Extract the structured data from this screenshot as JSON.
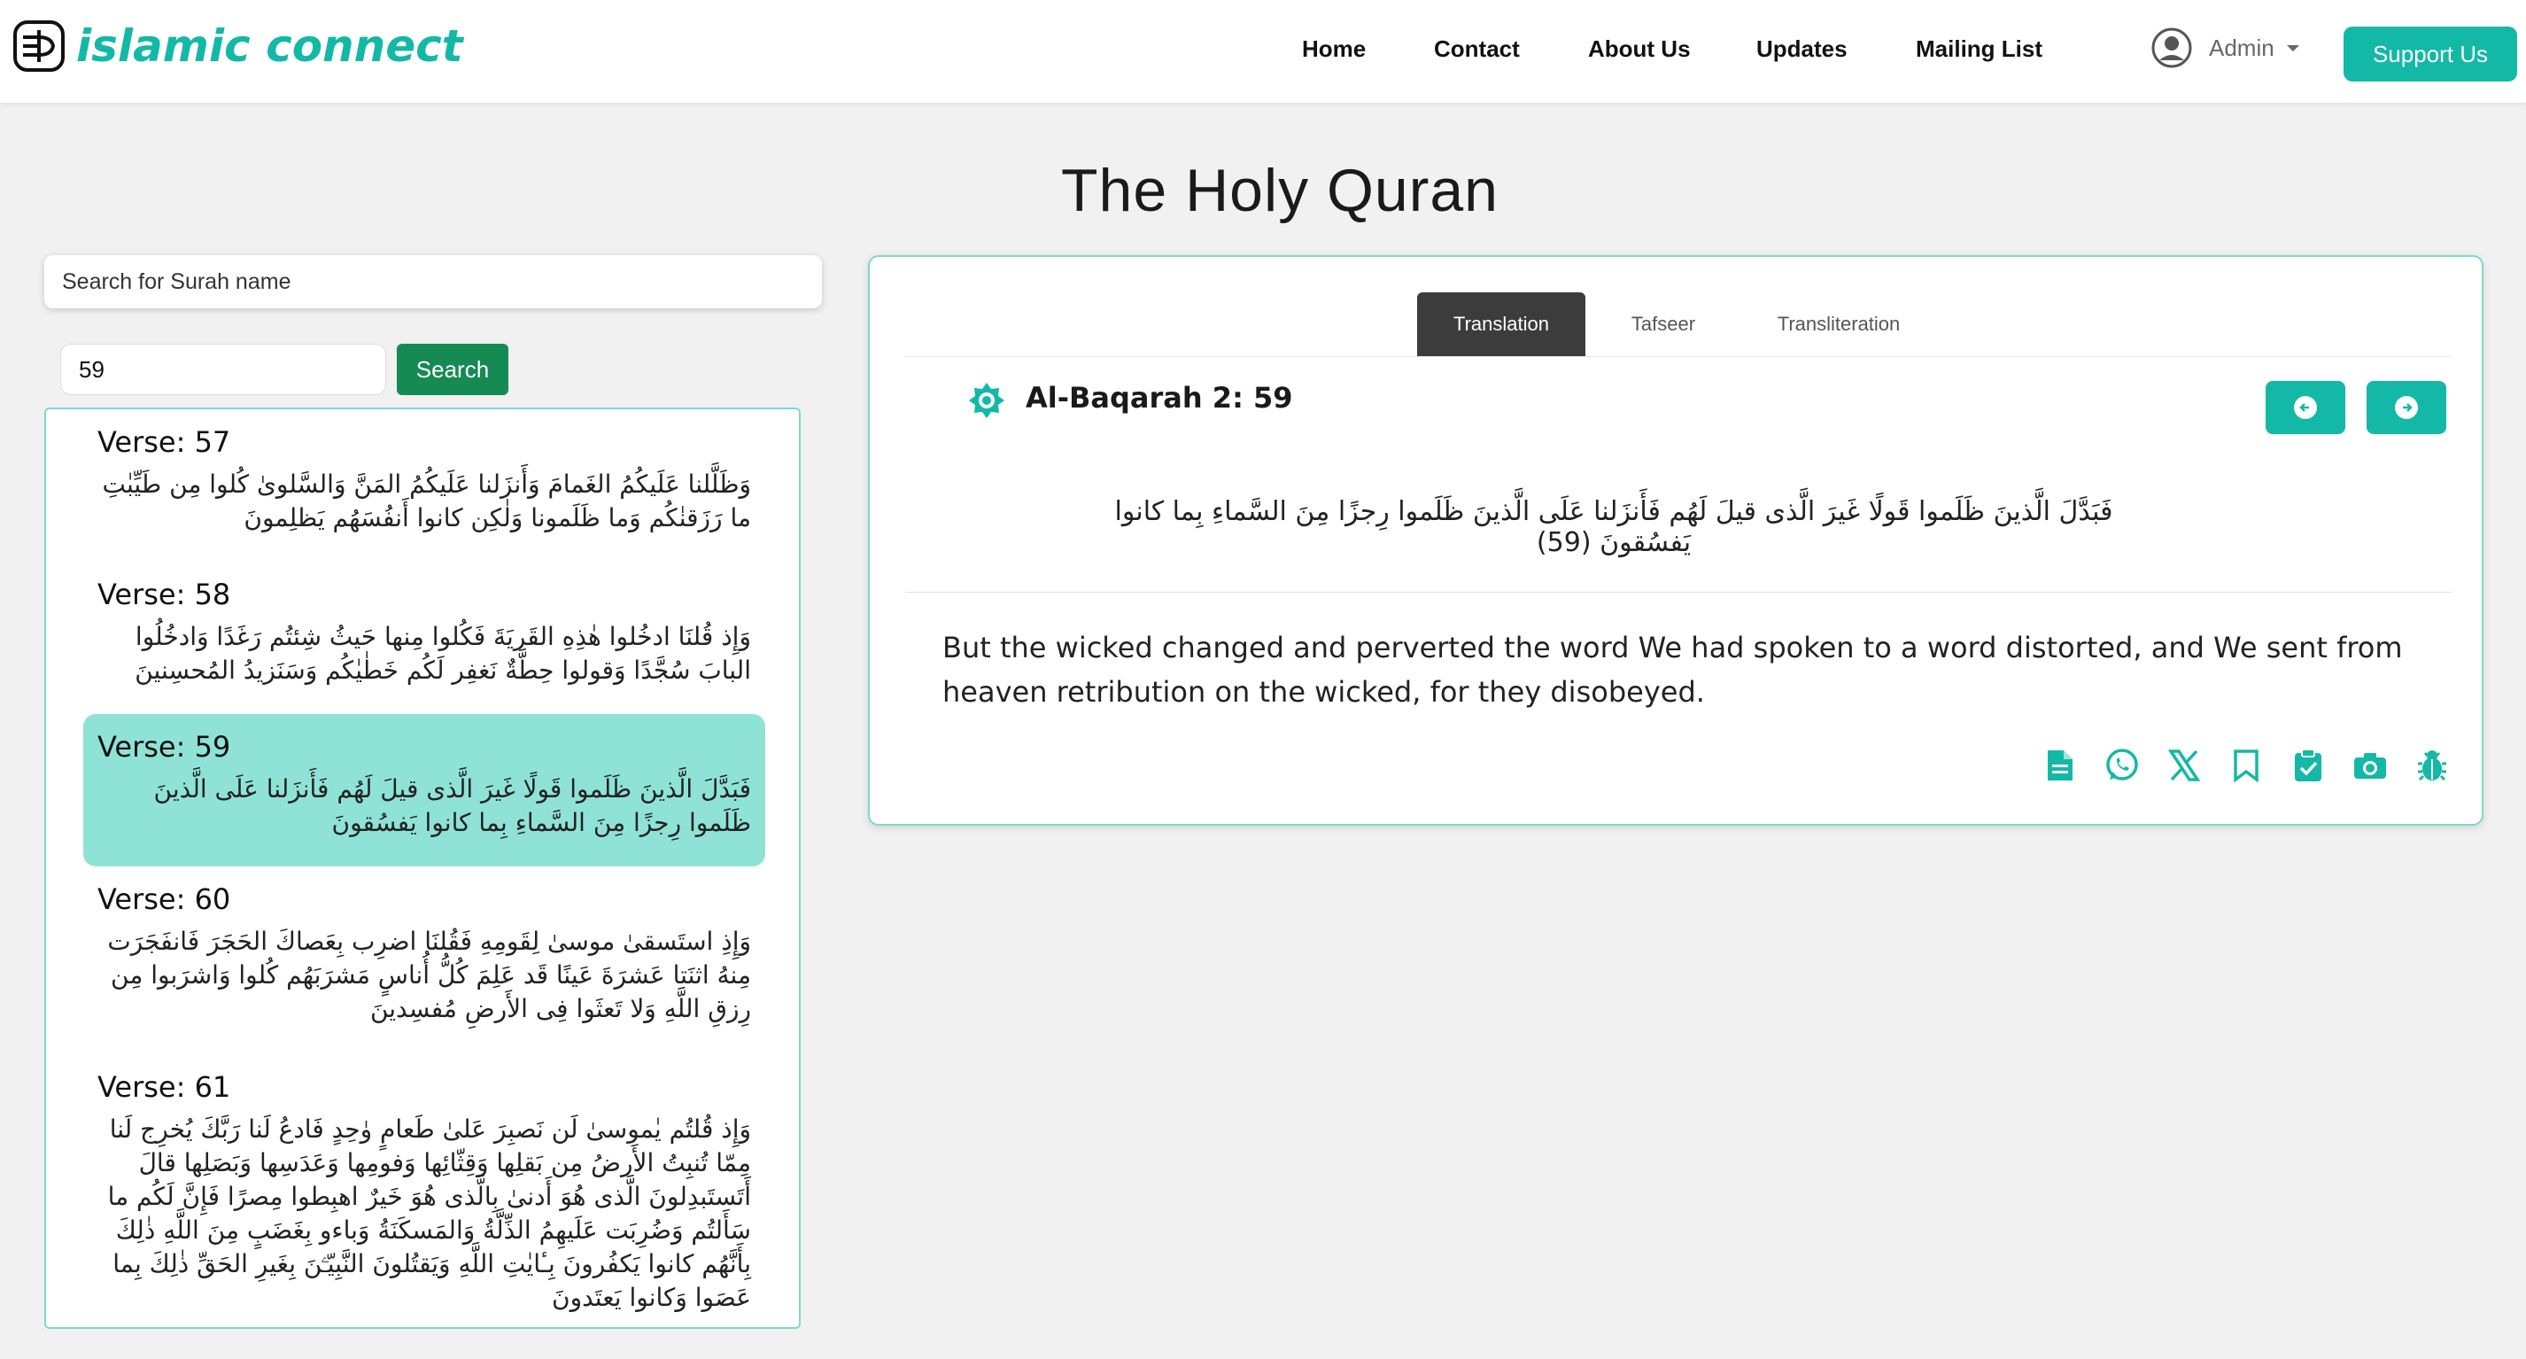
{
  "brand": {
    "name": "islamic connect",
    "color": "#14b8a6"
  },
  "nav": {
    "links": [
      "Home",
      "Contact",
      "About Us",
      "Updates",
      "Mailing List"
    ],
    "admin_label": "Admin",
    "support_label": "Support Us"
  },
  "page": {
    "title": "The Holy Quran"
  },
  "search": {
    "surah_placeholder": "Search for Surah name",
    "verse_value": "59",
    "button_label": "Search"
  },
  "verses": [
    {
      "label": "Verse: 57",
      "arabic": "وَظَلَّلنا عَلَيكُمُ الغَمامَ وَأَنزَلنا عَلَيكُمُ المَنَّ وَالسَّلوىٰ كُلوا مِن طَيِّبٰتِ ما رَزَقنٰكُم وَما ظَلَمونا وَلٰكِن كانوا أَنفُسَهُم يَظلِمونَ",
      "active": false
    },
    {
      "label": "Verse: 58",
      "arabic": "وَإِذ قُلنَا ادخُلوا هٰذِهِ القَريَةَ فَكُلوا مِنها حَيثُ شِئتُم رَغَدًا وَادخُلُوا البابَ سُجَّدًا وَقولوا حِطَّةٌ نَغفِر لَكُم خَطٰيٰكُم وَسَنَزيدُ المُحسِنينَ",
      "active": false
    },
    {
      "label": "Verse: 59",
      "arabic": "فَبَدَّلَ الَّذينَ ظَلَموا قَولًا غَيرَ الَّذى قيلَ لَهُم فَأَنزَلنا عَلَى الَّذينَ ظَلَموا رِجزًا مِنَ السَّماءِ بِما كانوا يَفسُقونَ",
      "active": true
    },
    {
      "label": "Verse: 60",
      "arabic": "وَإِذِ استَسقىٰ موسىٰ لِقَومِهِ فَقُلنَا اضرِب بِعَصاكَ الحَجَرَ فَانفَجَرَت مِنهُ اثنَتا عَشرَةَ عَينًا قَد عَلِمَ كُلُّ أُناسٍ مَشرَبَهُم كُلوا وَاشرَبوا مِن رِزقِ اللَّهِ وَلا تَعثَوا فِى الأَرضِ مُفسِدينَ",
      "active": false
    },
    {
      "label": "Verse: 61",
      "arabic": "وَإِذ قُلتُم يٰموسىٰ لَن نَصبِرَ عَلىٰ طَعامٍ وٰحِدٍ فَادعُ لَنا رَبَّكَ يُخرِج لَنا مِمّا تُنبِتُ الأَرضُ مِن بَقلِها وَقِثّائِها وَفومِها وَعَدَسِها وَبَصَلِها قالَ أَتَستَبدِلونَ الَّذى هُوَ أَدنىٰ بِالَّذى هُوَ خَيرٌ اهبِطوا مِصرًا فَإِنَّ لَكُم ما سَأَلتُم وَضُرِبَت عَلَيهِمُ الذِّلَّةُ وَالمَسكَنَةُ وَباءو بِغَضَبٍ مِنَ اللَّهِ ذٰلِكَ بِأَنَّهُم كانوا يَكفُرونَ بِـٔايٰتِ اللَّهِ وَيَقتُلونَ النَّبِيّـۧنَ بِغَيرِ الحَقِّ ذٰلِكَ بِما عَصَوا وَكانوا يَعتَدونَ",
      "active": false
    }
  ],
  "detail": {
    "tabs": [
      "Translation",
      "Tafseer",
      "Transliteration"
    ],
    "active_tab": "Translation",
    "reference": "Al-Baqarah 2: 59",
    "arabic": "فَبَدَّلَ الَّذينَ ظَلَموا قَولًا غَيرَ الَّذى قيلَ لَهُم فَأَنزَلنا عَلَى الَّذينَ ظَلَموا رِجزًا مِنَ السَّماءِ بِما كانوا يَفسُقونَ (59)",
    "translation": "But the wicked changed and perverted the word We had spoken to a word distorted, and We sent from heaven retribution on the wicked, for they disobeyed.",
    "actions": [
      "document-icon",
      "whatsapp-icon",
      "x-icon",
      "bookmark-icon",
      "clipboard-icon",
      "camera-icon",
      "bug-icon"
    ]
  }
}
